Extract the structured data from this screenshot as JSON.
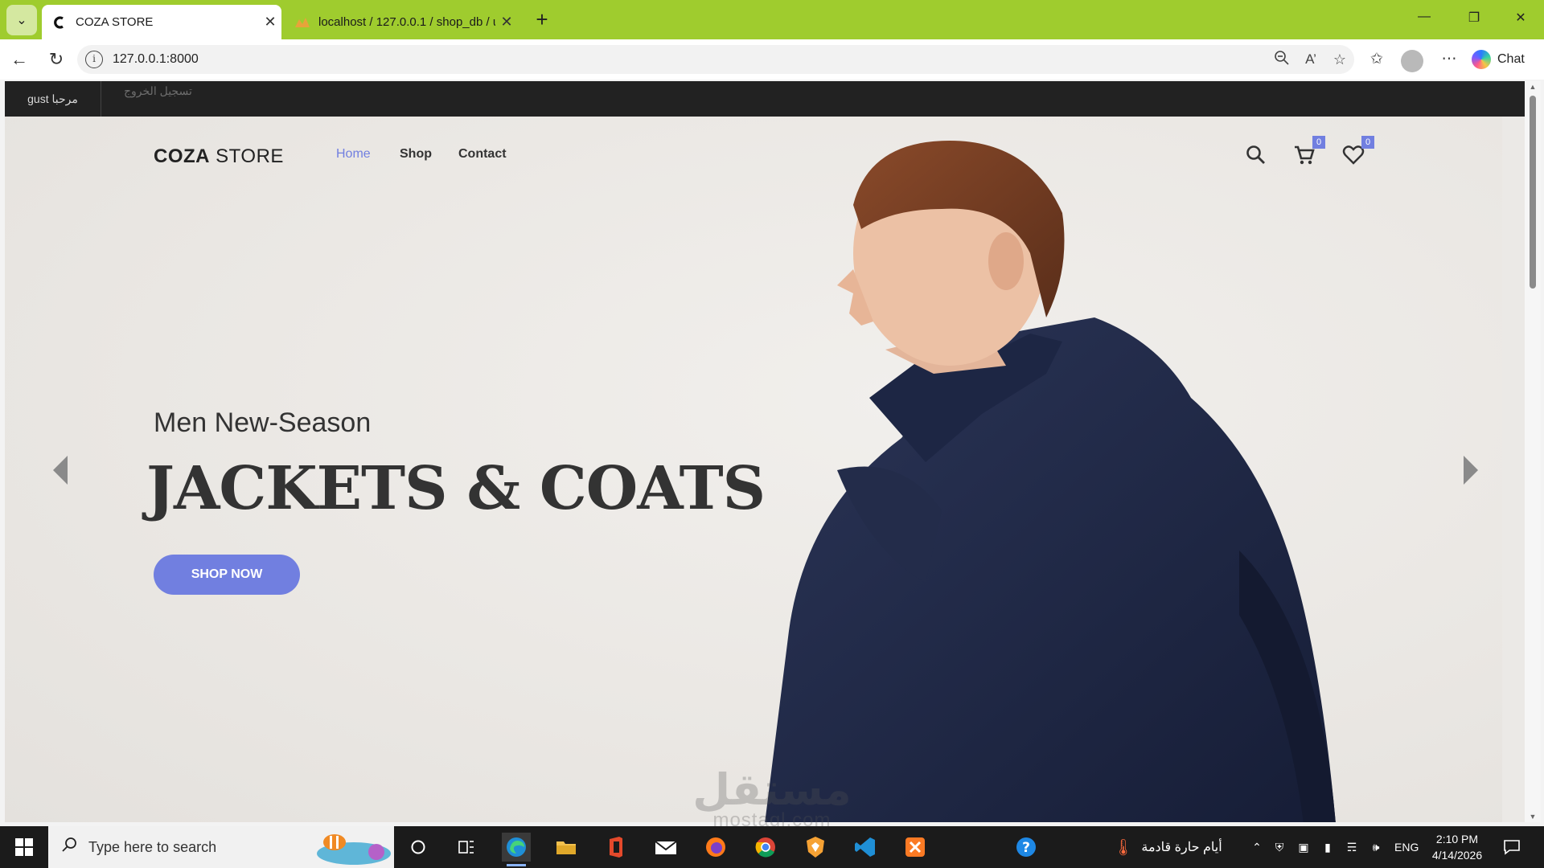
{
  "browser": {
    "tabs": [
      {
        "title": "COZA STORE",
        "active": true
      },
      {
        "title": "localhost / 127.0.0.1 / shop_db / u",
        "active": false
      }
    ],
    "url": "127.0.0.1:8000",
    "chat_label": "Chat"
  },
  "topbar": {
    "greeting": "مرحبا gust",
    "logout": "تسجيل الخروج"
  },
  "header": {
    "logo_bold": "COZA",
    "logo_light": " STORE",
    "nav": [
      {
        "label": "Home",
        "active": true
      },
      {
        "label": "Shop",
        "active": false
      },
      {
        "label": "Contact",
        "active": false
      }
    ],
    "cart_count": "0",
    "wishlist_count": "0"
  },
  "hero": {
    "subtitle": "Men New-Season",
    "headline": "JACKETS & COATS",
    "cta": "SHOP NOW"
  },
  "watermark": {
    "arabic": "مستقل",
    "latin": "mostaql.com"
  },
  "taskbar": {
    "search_placeholder": "Type here to search",
    "weather": "أيام حارة قادمة",
    "language": "ENG",
    "time": "2:10 PM",
    "date": "4/14/2026"
  },
  "colors": {
    "accent": "#717fe0",
    "tabbar": "#9fcc2e",
    "topstrip": "#222222"
  }
}
